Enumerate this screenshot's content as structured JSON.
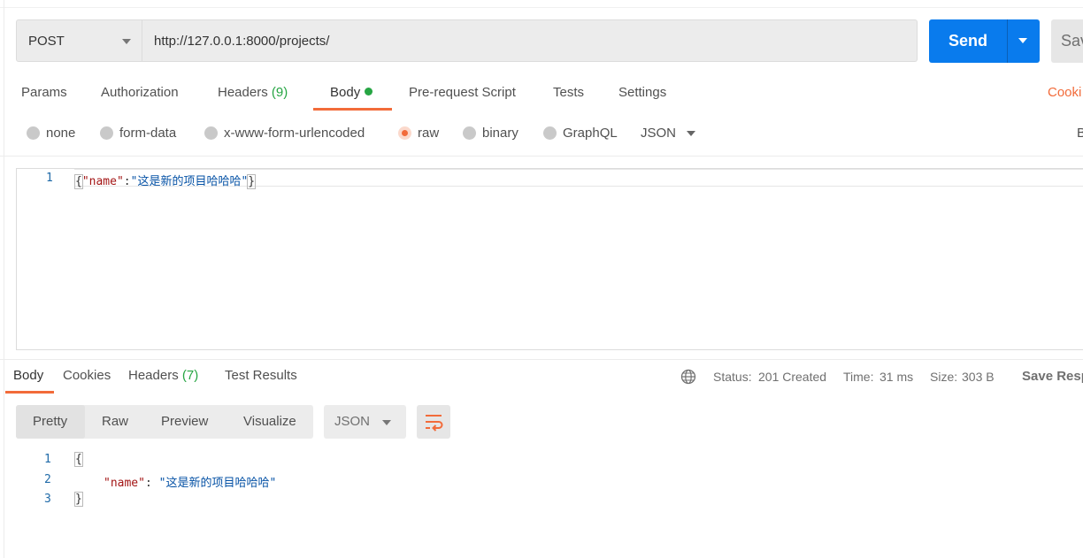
{
  "request": {
    "method": "POST",
    "url": "http://127.0.0.1:8000/projects/",
    "send_label": "Send",
    "save_label": "Sav"
  },
  "request_tabs": {
    "params": "Params",
    "authorization": "Authorization",
    "headers": "Headers",
    "headers_count": "(9)",
    "body": "Body",
    "prerequest": "Pre-request Script",
    "tests": "Tests",
    "settings": "Settings",
    "cookies": "Cooki"
  },
  "body_types": {
    "none": "none",
    "form_data": "form-data",
    "urlencoded": "x-www-form-urlencoded",
    "raw": "raw",
    "binary": "binary",
    "graphql": "GraphQL",
    "format": "JSON",
    "beautify": "B",
    "selected": "raw"
  },
  "request_body": {
    "line_number": "1",
    "open": "{",
    "key": "\"name\"",
    "colon": ":",
    "value": "\"这是新的项目哈哈哈\"",
    "close": "}"
  },
  "response_tabs": {
    "body": "Body",
    "cookies": "Cookies",
    "headers": "Headers",
    "headers_count": "(7)",
    "test_results": "Test Results"
  },
  "response_status": {
    "status_label": "Status:",
    "status_value": "201 Created",
    "time_label": "Time:",
    "time_value": "31 ms",
    "size_label": "Size:",
    "size_value": "303 B",
    "save_response": "Save Resp"
  },
  "response_view": {
    "pretty": "Pretty",
    "raw": "Raw",
    "preview": "Preview",
    "visualize": "Visualize",
    "format": "JSON"
  },
  "response_body": {
    "lines": [
      "1",
      "2",
      "3"
    ],
    "open": "{",
    "key": "\"name\"",
    "colon": ": ",
    "value": "\"这是新的项目哈哈哈\"",
    "close": "}"
  },
  "colors": {
    "accent": "#f26b3a",
    "primary": "#097bed",
    "success": "#26a543"
  }
}
